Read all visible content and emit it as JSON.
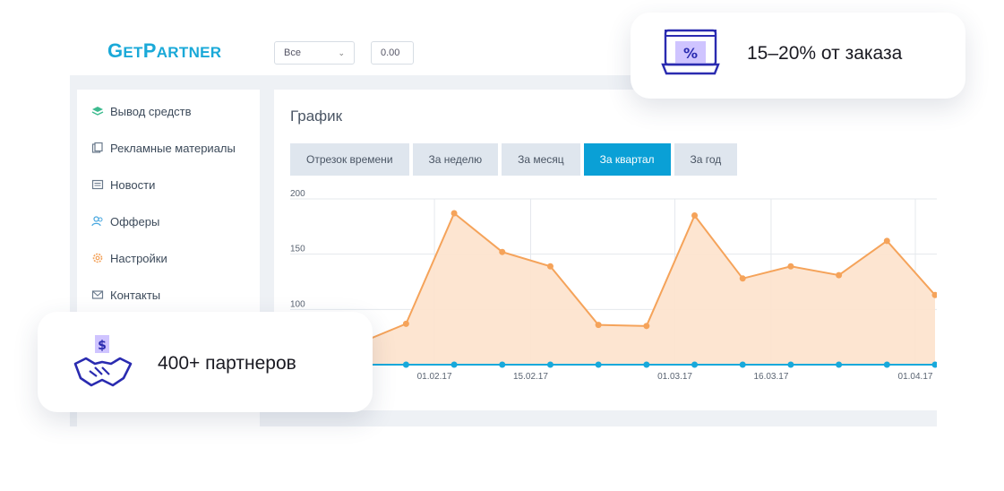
{
  "header": {
    "logo_first": "G",
    "logo_rest1": "ET",
    "logo_p": "P",
    "logo_rest2": "ARTNER",
    "filter_select": "Все",
    "amount_value": "0.00"
  },
  "sidebar": {
    "items": [
      {
        "label": "Вывод средств",
        "icon": "layers-icon",
        "color": "#3dbb8f"
      },
      {
        "label": "Рекламные материалы",
        "icon": "folders-icon",
        "color": "#6a7a8c"
      },
      {
        "label": "Новости",
        "icon": "newspaper-icon",
        "color": "#6a7a8c"
      },
      {
        "label": "Офферы",
        "icon": "users-icon",
        "color": "#4aa8e0"
      },
      {
        "label": "Настройки",
        "icon": "gear-icon",
        "color": "#f3a35c"
      },
      {
        "label": "Контакты",
        "icon": "mail-icon",
        "color": "#6a7a8c"
      }
    ]
  },
  "main": {
    "title": "График",
    "tabs": [
      {
        "label": "Отрезок времени",
        "active": false
      },
      {
        "label": "За неделю",
        "active": false
      },
      {
        "label": "За месяц",
        "active": false
      },
      {
        "label": "За квартал",
        "active": true
      },
      {
        "label": "За год",
        "active": false
      }
    ]
  },
  "chart_data": {
    "type": "area",
    "y_ticks": [
      "200",
      "150",
      "100"
    ],
    "x_tick_labels": [
      "01.02.17",
      "15.02.17",
      "01.03.17",
      "16.03.17",
      "01.04.17"
    ],
    "ylim": [
      50,
      200
    ],
    "series": [
      {
        "color": "#f5a35a",
        "values": [
          70,
          69,
          87,
          187,
          152,
          139,
          86,
          85,
          185,
          128,
          139,
          131,
          162,
          113
        ]
      },
      {
        "color": "#18a9db",
        "values": [
          50,
          50,
          50,
          50,
          50,
          50,
          50,
          50,
          50,
          50,
          50,
          50,
          50,
          50
        ]
      }
    ]
  },
  "cards": {
    "commission": "15–20% от заказа",
    "partners": "400+ партнеров",
    "percent_symbol": "%",
    "dollar_symbol": "$"
  },
  "colors": {
    "accent": "#0aa0d6",
    "orange": "#f5a35a",
    "purple": "#2a2bb0",
    "lavender": "#cfc4ff"
  }
}
